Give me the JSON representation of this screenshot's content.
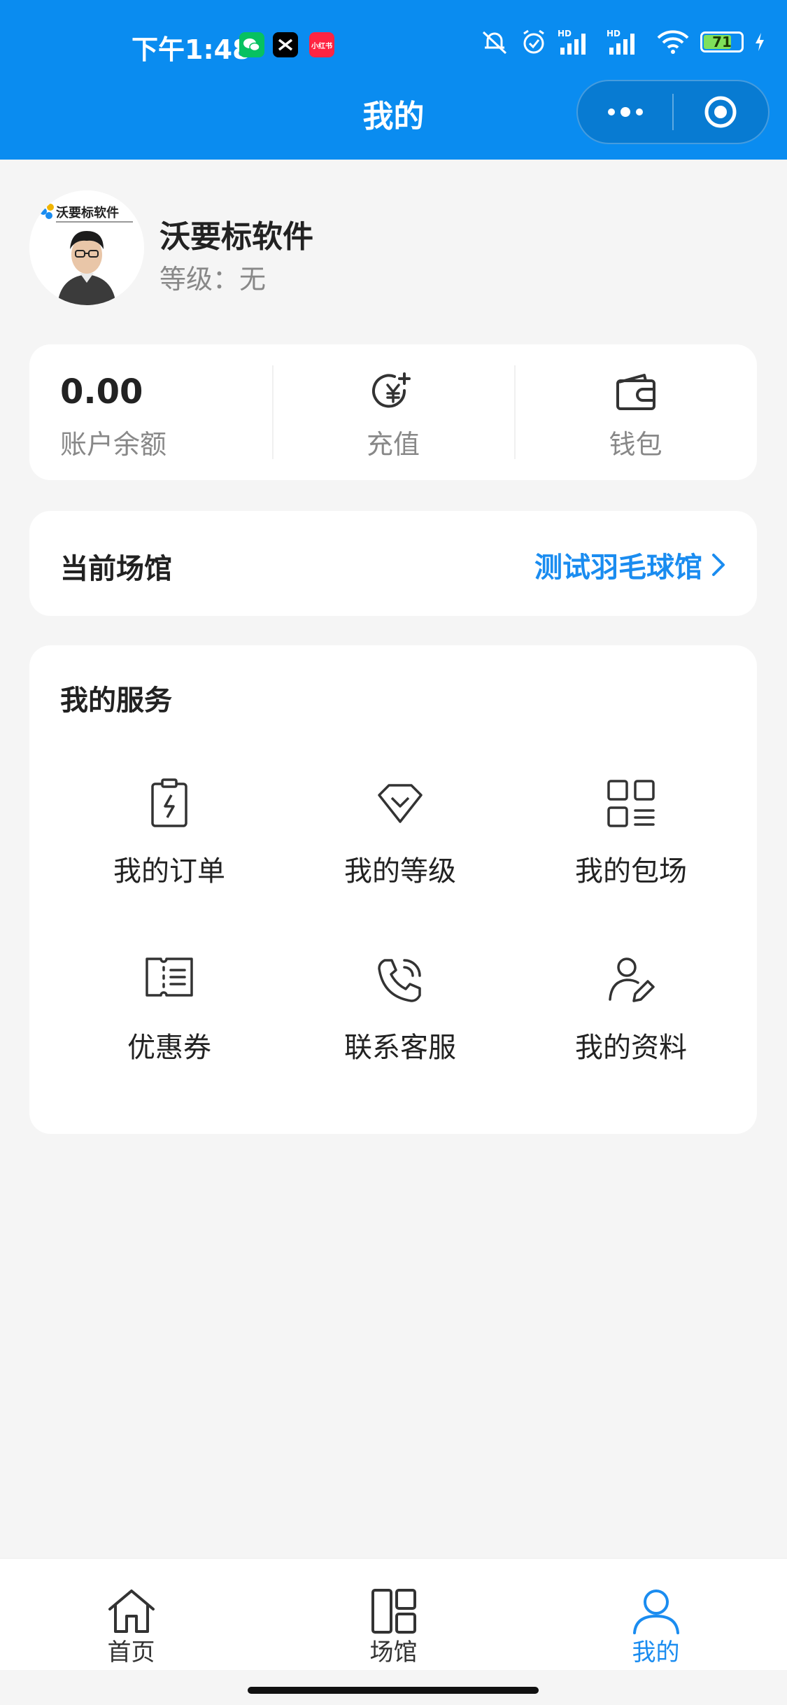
{
  "status_bar": {
    "time": "下午1:48",
    "app_badge_text": "小红书",
    "battery_level": "71"
  },
  "nav": {
    "title": "我的"
  },
  "profile": {
    "name": "沃要标软件",
    "level_text": "等级：无",
    "avatar_logo_text": "沃要标软件"
  },
  "balance": {
    "amount": "0.00",
    "amount_label": "账户余额",
    "recharge_label": "充值",
    "wallet_label": "钱包"
  },
  "venue": {
    "label": "当前场馆",
    "value": "测试羽毛球馆"
  },
  "services": {
    "title": "我的服务",
    "items": [
      {
        "label": "我的订单",
        "icon": "order-clipboard-icon"
      },
      {
        "label": "我的等级",
        "icon": "diamond-icon"
      },
      {
        "label": "我的包场",
        "icon": "grid-list-icon"
      },
      {
        "label": "优惠券",
        "icon": "coupon-icon"
      },
      {
        "label": "联系客服",
        "icon": "phone-call-icon"
      },
      {
        "label": "我的资料",
        "icon": "user-edit-icon"
      }
    ]
  },
  "tabbar": {
    "items": [
      {
        "label": "首页",
        "icon": "home-icon"
      },
      {
        "label": "场馆",
        "icon": "venue-grid-icon"
      },
      {
        "label": "我的",
        "icon": "user-icon"
      }
    ],
    "active_index": 2
  },
  "colors": {
    "header_bg": "#0a8cf0",
    "accent": "#1a8cf0",
    "page_bg": "#f5f5f5"
  }
}
